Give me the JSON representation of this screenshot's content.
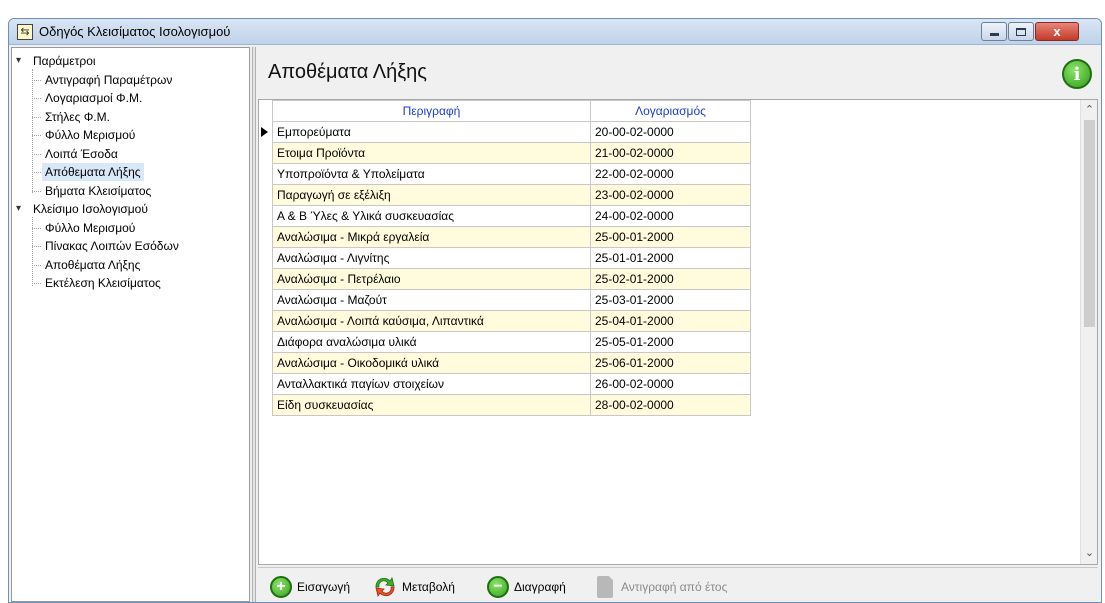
{
  "window": {
    "title": "Οδηγός Κλεισίματος Ισολογισμού",
    "close_glyph": "x"
  },
  "tree": {
    "groups": [
      {
        "label": "Παράμετροι",
        "children": [
          "Αντιγραφή Παραμέτρων",
          "Λογαριασμοί Φ.Μ.",
          "Στήλες Φ.Μ.",
          "Φύλλο Μερισμού",
          "Λοιπά Έσοδα",
          "Απόθεματα Λήξης",
          "Βήματα Κλεισίματος"
        ]
      },
      {
        "label": "Κλείσιμο Ισολογισμού",
        "children": [
          "Φύλλο Μερισμού",
          "Πίνακας Λοιπών Εσόδων",
          "Αποθέματα Λήξης",
          "Εκτέλεση Κλεισίματος"
        ]
      }
    ],
    "selected": "Απόθεματα Λήξης"
  },
  "main": {
    "title": "Αποθέματα Λήξης",
    "info_glyph": "i"
  },
  "grid": {
    "columns": [
      "Περιγραφή",
      "Λογαριασμός"
    ],
    "rows": [
      [
        "Εμπορεύματα",
        "20-00-02-0000"
      ],
      [
        "Ετοιμα Προϊόντα",
        "21-00-02-0000"
      ],
      [
        "Υποπροϊόντα & Υπολείματα",
        "22-00-02-0000"
      ],
      [
        "Παραγωγή σε εξέλιξη",
        "23-00-02-0000"
      ],
      [
        "Α & Β Ύλες & Υλικά συσκευασίας",
        "24-00-02-0000"
      ],
      [
        "Αναλώσιμα - Μικρά εργαλεία",
        "25-00-01-2000"
      ],
      [
        "Αναλώσιμα - Λιγνίτης",
        "25-01-01-2000"
      ],
      [
        "Αναλώσιμα - Πετρέλαιο",
        "25-02-01-2000"
      ],
      [
        "Αναλώσιμα - Μαζούτ",
        "25-03-01-2000"
      ],
      [
        "Αναλώσιμα - Λοιπά καύσιμα, Λιπαντικά",
        "25-04-01-2000"
      ],
      [
        "Διάφορα αναλώσιμα υλικά",
        "25-05-01-2000"
      ],
      [
        "Αναλώσιμα - Οικοδομικά υλικά",
        "25-06-01-2000"
      ],
      [
        "Ανταλλακτικά παγίων στοιχείων",
        "26-00-02-0000"
      ],
      [
        "Είδη συσκευασίας",
        "28-00-02-0000"
      ]
    ],
    "current_row": 0
  },
  "toolbar": {
    "insert_label": "Εισαγωγή",
    "insert_glyph": "+",
    "edit_label": "Μεταβολή",
    "delete_label": "Διαγραφή",
    "delete_glyph": "−",
    "copy_label": "Αντιγραφή από έτος"
  },
  "colors": {
    "header_text": "#1c3cc8",
    "alt_row": "#fffbdc",
    "info_green": "#2f9a1c"
  }
}
